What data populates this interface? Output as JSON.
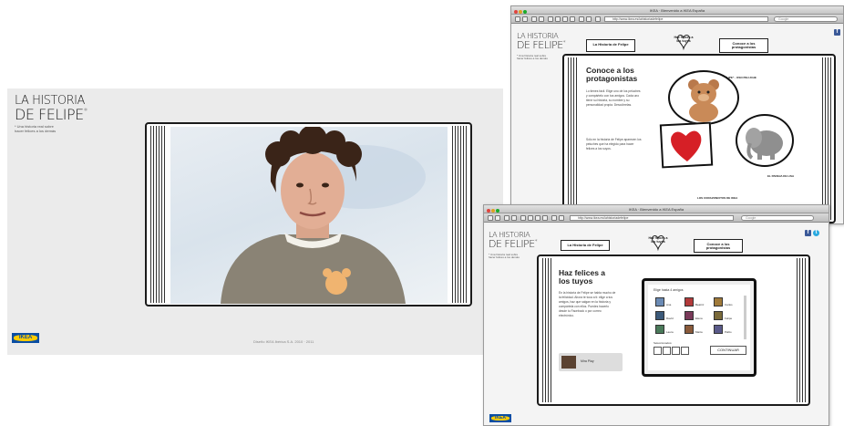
{
  "panel1": {
    "logo_line1": "LA HISTORIA",
    "logo_line2": "DE FELIPE",
    "logo_star": "*",
    "tagline1": "* Una historia real sobre",
    "tagline2": "hacer felices a los demás",
    "ikea": "IKEA",
    "footer": "Diseño IKEA Ibérica S.A. 2010 · 2011"
  },
  "panel2": {
    "window_title": "IKEA · Bienvenido a IKEA España",
    "url": "http://www.ikea.es/lahistoriadefelipe",
    "search_placeholder": "Google",
    "logo_line1": "LA HISTORIA",
    "logo_line2": "DE FELIPE",
    "logo_star": "*",
    "tagline1": "* Una historia real sobre",
    "tagline2": "hacer felices a los demás",
    "tab1": "La Historia de Felipe",
    "heart_label": "Haz felices a los tuyos",
    "tab3": "Conoce a los protagonistas",
    "fb": "f",
    "heading": "Conoce a los protagonistas",
    "body1": "Lo tienes fácil. Elige uno de los peluches y compártelo con tus amigos. Cada uno tiene su historia, su nombre y su personalidad propia. Descúbrelas.",
    "body2": "Sólo en la historia de Felipe aparecen los peluches que ha elegido para hacer felices a los suyos.",
    "label_top": "\"FELIPE\" · OSO PELUCHE",
    "label_right": "EL PAREJA DE LISA",
    "label_bottom": "LOS CORAZONCITOS DE IKEA"
  },
  "panel3": {
    "window_title": "IKEA · Bienvenido a IKEA España",
    "url": "http://www.ikea.es/lahistoriadefelipe",
    "search_placeholder": "Google",
    "logo_line1": "LA HISTORIA",
    "logo_line2": "DE FELIPE",
    "logo_star": "*",
    "tagline1": "* Una historia real sobre",
    "tagline2": "hacer felices a los demás",
    "tab1": "La Historia de Felipe",
    "heart_label": "Haz felices a los tuyos",
    "tab3": "Conoce a los protagonistas",
    "fb": "f",
    "tw": "t",
    "heading": "Haz felices a los tuyos",
    "body": "En la historia de Felipe se habla mucho de la felicidad. Ahora te toca a ti: elige a tus amigos, haz que salgan en la historia y compártela con ellos. Puedes hacerlo desde tu Facebook o por correo electrónico.",
    "grid_title": "Elige hasta 4 amigos",
    "friend_names": [
      "Ana",
      "Beatriz",
      "Carlos",
      "David",
      "Elena",
      "Felipe",
      "Laura",
      "Marta",
      "Pablo"
    ],
    "selected_label": "Seleccionados:",
    "continue": "CONTINUAR",
    "thumb_label": "Mira Play",
    "ikea": "IKEA"
  }
}
